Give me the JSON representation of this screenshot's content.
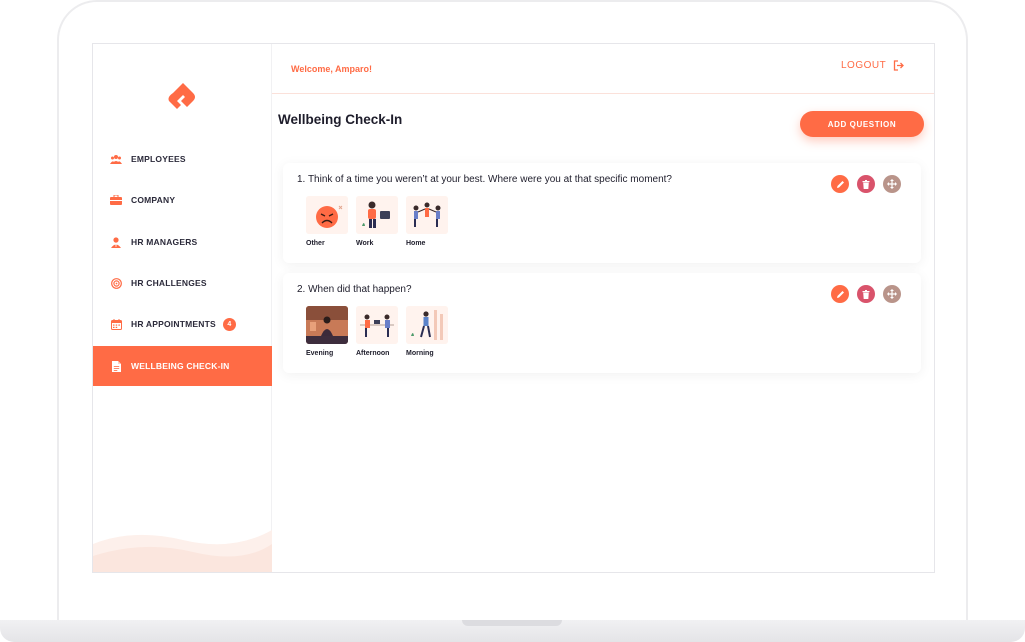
{
  "header": {
    "welcome": "Welcome, Amparo!",
    "logout_label": "LOGOUT"
  },
  "sidebar": {
    "items": [
      {
        "label": "EMPLOYEES",
        "icon": "users-icon"
      },
      {
        "label": "COMPANY",
        "icon": "briefcase-icon"
      },
      {
        "label": "HR MANAGERS",
        "icon": "user-tie-icon"
      },
      {
        "label": "HR CHALLENGES",
        "icon": "target-icon"
      },
      {
        "label": "HR APPOINTMENTS",
        "icon": "calendar-icon",
        "badge": "4"
      },
      {
        "label": "WELLBEING CHECK-IN",
        "icon": "document-icon",
        "active": true
      }
    ]
  },
  "main": {
    "title": "Wellbeing Check-In",
    "add_button": "ADD QUESTION",
    "questions": [
      {
        "text": "1. Think of a time you weren’t at your best. Where were you at that specific moment?",
        "options": [
          {
            "label": "Other"
          },
          {
            "label": "Work"
          },
          {
            "label": "Home"
          }
        ]
      },
      {
        "text": "2. When did that happen?",
        "options": [
          {
            "label": "Evening"
          },
          {
            "label": "Afternoon"
          },
          {
            "label": "Morning"
          }
        ]
      }
    ]
  },
  "colors": {
    "accent": "#ff6b45",
    "delete": "#d9536b",
    "move": "#b9948a"
  }
}
